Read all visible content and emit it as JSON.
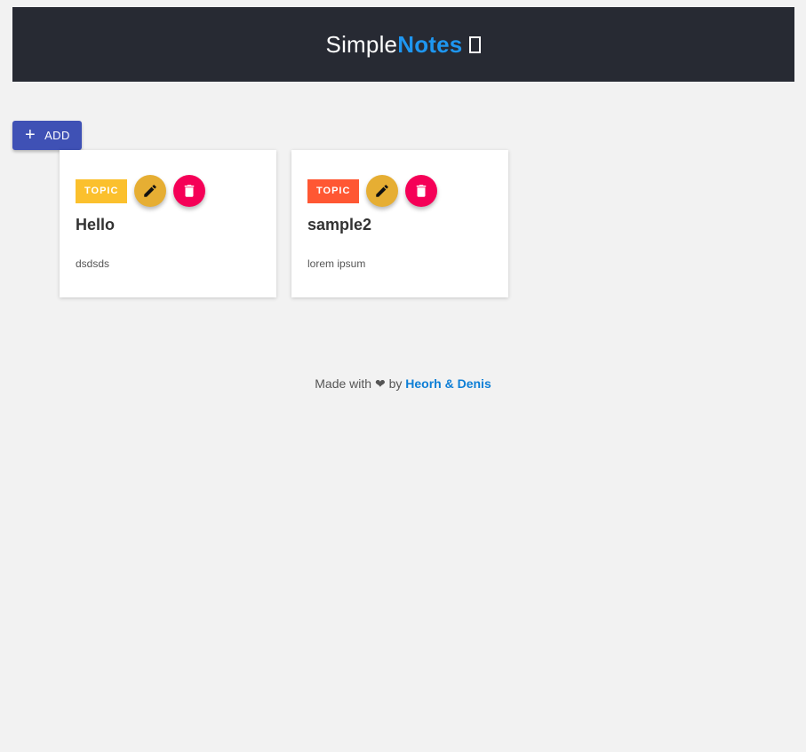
{
  "header": {
    "brand_part1": "Simple",
    "brand_part2": "Notes",
    "brand_icon": "note-square-icon"
  },
  "toolbar": {
    "add_icon": "plus-icon",
    "add_label": "ADD"
  },
  "notes": [
    {
      "tag": "TOPIC",
      "tag_color": "#fbc02d",
      "title": "Hello",
      "body": "dsdsds",
      "edit_icon": "pencil-icon",
      "delete_icon": "trash-icon"
    },
    {
      "tag": "TOPIC",
      "tag_color": "#ff5733",
      "title": "sample2",
      "body": "lorem ipsum",
      "edit_icon": "pencil-icon",
      "delete_icon": "trash-icon"
    }
  ],
  "footer": {
    "prefix": "Made with",
    "heart": "❤",
    "by": "by",
    "authors": "Heorh & Denis"
  },
  "colors": {
    "header_bg": "#272a33",
    "brand_accent": "#1e96f0",
    "add_button": "#3f51b5",
    "edit_button": "#e6ae33",
    "delete_button": "#f50057",
    "link": "#0e7fd6"
  }
}
